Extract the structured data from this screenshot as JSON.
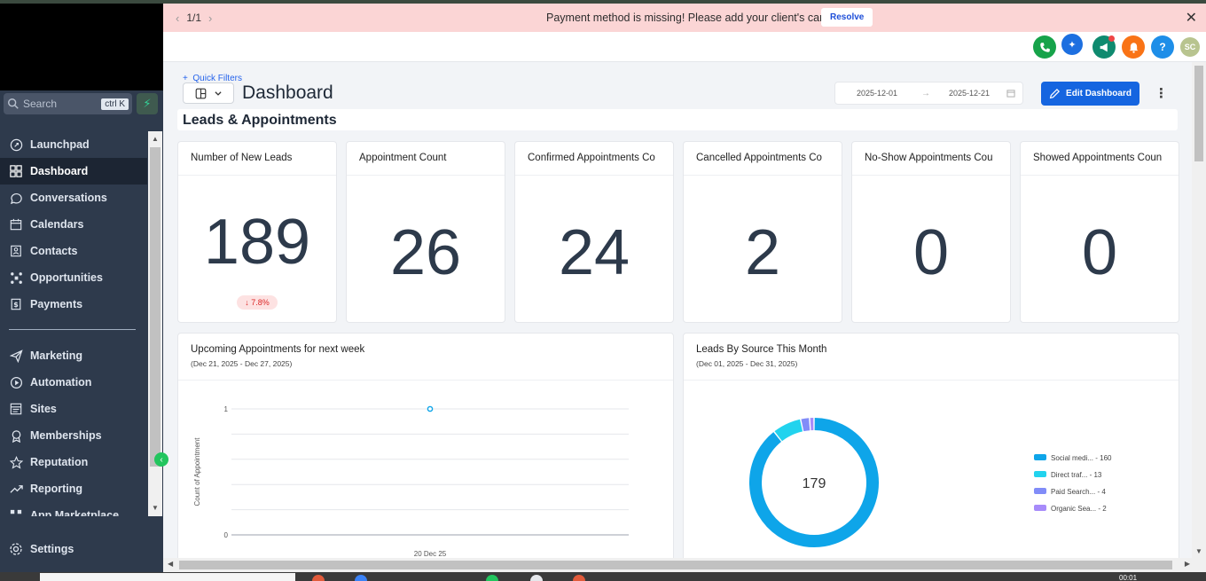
{
  "banner": {
    "pager": "1/1",
    "message": "Payment method is missing! Please add your client's card.",
    "resolve_label": "Resolve"
  },
  "header": {
    "avatar_initials": "SC",
    "help_label": "?"
  },
  "sidebar": {
    "search_placeholder": "Search",
    "search_shortcut": "ctrl K",
    "items": [
      {
        "label": "Launchpad",
        "icon": "rocket-icon"
      },
      {
        "label": "Dashboard",
        "icon": "grid-icon",
        "active": true
      },
      {
        "label": "Conversations",
        "icon": "chat-icon"
      },
      {
        "label": "Calendars",
        "icon": "calendar-icon"
      },
      {
        "label": "Contacts",
        "icon": "contacts-icon"
      },
      {
        "label": "Opportunities",
        "icon": "funnel-icon"
      },
      {
        "label": "Payments",
        "icon": "receipt-icon"
      }
    ],
    "items2": [
      {
        "label": "Marketing",
        "icon": "send-icon"
      },
      {
        "label": "Automation",
        "icon": "automation-icon"
      },
      {
        "label": "Sites",
        "icon": "sites-icon"
      },
      {
        "label": "Memberships",
        "icon": "membership-icon"
      },
      {
        "label": "Reputation",
        "icon": "star-icon"
      },
      {
        "label": "Reporting",
        "icon": "trend-icon"
      },
      {
        "label": "App Marketplace",
        "icon": "apps-icon"
      }
    ],
    "settings_label": "Settings"
  },
  "toolbar": {
    "quick_filters": "Quick Filters",
    "page_title": "Dashboard",
    "date_from": "2025-12-01",
    "date_to": "2025-12-21",
    "edit_label": "Edit Dashboard"
  },
  "section_title": "Leads & Appointments",
  "stat_cards": [
    {
      "title": "Number of New Leads",
      "value": "189",
      "trend": "7.8%"
    },
    {
      "title": "Appointment Count",
      "value": "26"
    },
    {
      "title": "Confirmed Appointments Co",
      "value": "24"
    },
    {
      "title": "Cancelled Appointments Co",
      "value": "2"
    },
    {
      "title": "No-Show Appointments Cou",
      "value": "0"
    },
    {
      "title": "Showed Appointments Coun",
      "value": "0"
    }
  ],
  "upcoming": {
    "title": "Upcoming Appointments for next week",
    "subtitle": "(Dec 21, 2025 - Dec 27, 2025)"
  },
  "leads_source": {
    "title": "Leads By Source This Month",
    "subtitle": "(Dec 01, 2025 - Dec 31, 2025)",
    "center_label": "179"
  },
  "taskbar": {
    "time": "00:01"
  },
  "colors": {
    "accent": "#1565e0",
    "sidebar": "#2e3a4c",
    "banner": "#fbd5d5"
  },
  "chart_data": [
    {
      "type": "line",
      "x": [
        "20 Dec 25"
      ],
      "series": [
        {
          "values": [
            1
          ]
        }
      ],
      "xlabel": "",
      "ylabel": "Count of Appointment",
      "ylim": [
        0,
        1
      ],
      "y_ticks": [
        "0",
        "1"
      ],
      "grid": true
    },
    {
      "type": "pie",
      "categories": [
        "Social medi...",
        "Direct traf...",
        "Paid Search...",
        "Organic Sea..."
      ],
      "values": [
        160,
        13,
        4,
        2
      ],
      "legend_labels": [
        "Social medi... - 160",
        "Direct traf... - 13",
        "Paid Search... - 4",
        "Organic Sea... - 2"
      ],
      "colors": [
        "#0ea5e9",
        "#22d3ee",
        "#818cf8",
        "#a78bfa"
      ],
      "center_total": 179,
      "legend": "right"
    }
  ]
}
